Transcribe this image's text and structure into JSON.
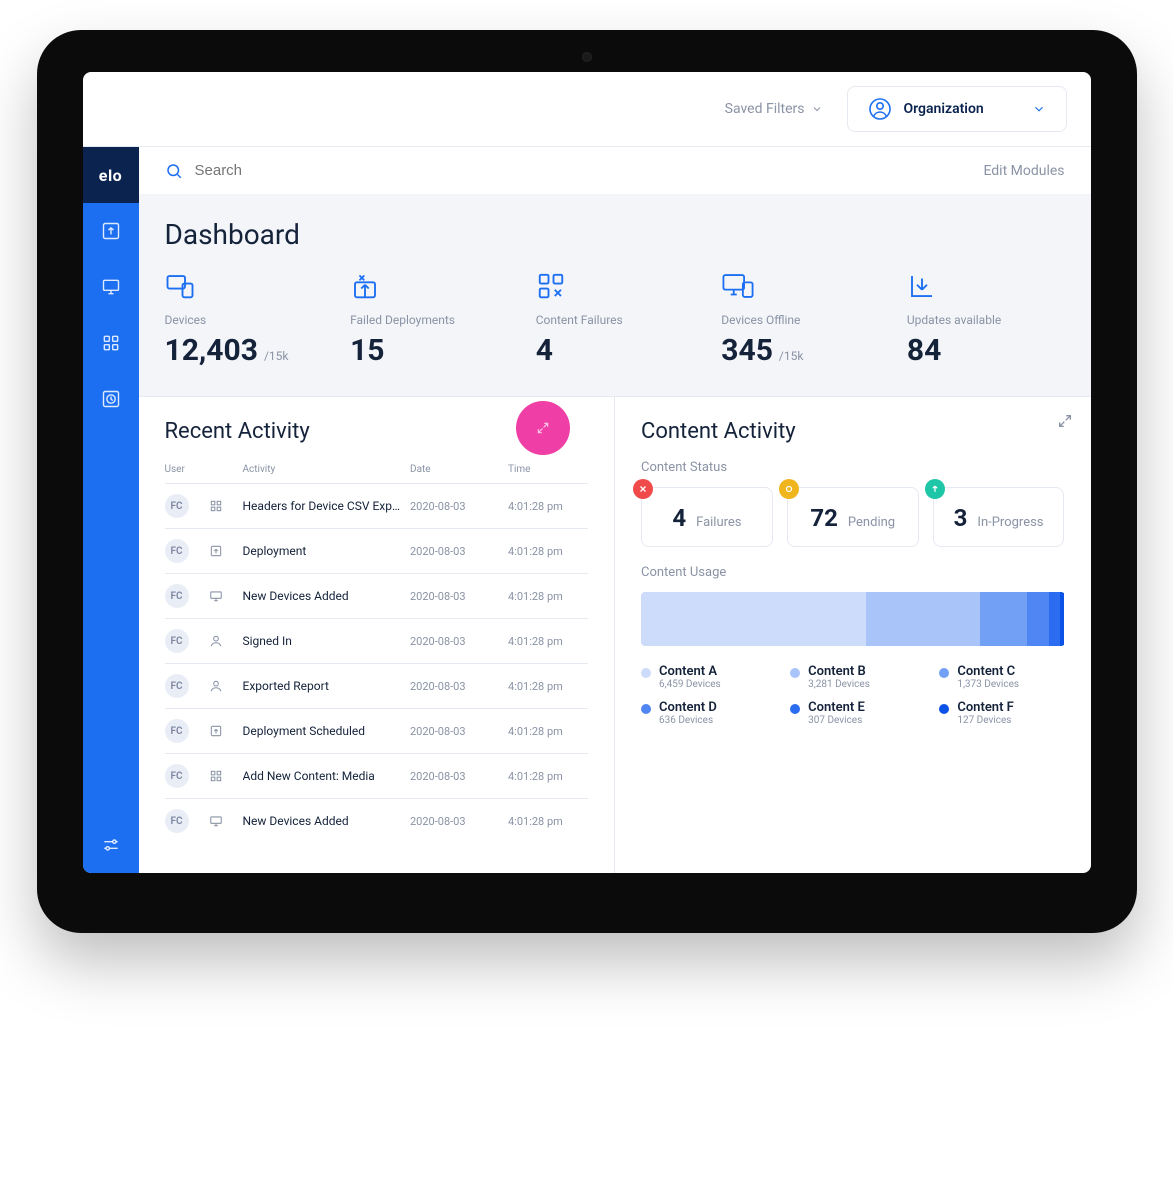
{
  "brand": {
    "logo_text": "elo"
  },
  "header": {
    "saved_filters_label": "Saved Filters",
    "organization_label": "Organization"
  },
  "search": {
    "placeholder": "Search",
    "edit_modules_label": "Edit Modules"
  },
  "dashboard": {
    "title": "Dashboard",
    "stats": [
      {
        "label": "Devices",
        "value": "12,403",
        "suffix": "/15k"
      },
      {
        "label": "Failed Deployments",
        "value": "15",
        "suffix": ""
      },
      {
        "label": "Content Failures",
        "value": "4",
        "suffix": ""
      },
      {
        "label": "Devices Offline",
        "value": "345",
        "suffix": "/15k"
      },
      {
        "label": "Updates available",
        "value": "84",
        "suffix": ""
      }
    ]
  },
  "recent_activity": {
    "title": "Recent Activity",
    "columns": {
      "user": "User",
      "activity": "Activity",
      "date": "Date",
      "time": "Time"
    },
    "rows": [
      {
        "user": "FC",
        "icon": "grid",
        "desc": "Headers for Device CSV Expo...",
        "date": "2020-08-03",
        "time": "4:01:28 pm"
      },
      {
        "user": "FC",
        "icon": "upload",
        "desc": "Deployment",
        "date": "2020-08-03",
        "time": "4:01:28 pm"
      },
      {
        "user": "FC",
        "icon": "monitor",
        "desc": "New Devices Added",
        "date": "2020-08-03",
        "time": "4:01:28 pm"
      },
      {
        "user": "FC",
        "icon": "person",
        "desc": "Signed In",
        "date": "2020-08-03",
        "time": "4:01:28 pm"
      },
      {
        "user": "FC",
        "icon": "person",
        "desc": "Exported Report",
        "date": "2020-08-03",
        "time": "4:01:28 pm"
      },
      {
        "user": "FC",
        "icon": "upload",
        "desc": "Deployment Scheduled",
        "date": "2020-08-03",
        "time": "4:01:28 pm"
      },
      {
        "user": "FC",
        "icon": "grid",
        "desc": "Add New Content: Media",
        "date": "2020-08-03",
        "time": "4:01:28 pm"
      },
      {
        "user": "FC",
        "icon": "monitor",
        "desc": "New Devices Added",
        "date": "2020-08-03",
        "time": "4:01:28 pm"
      }
    ]
  },
  "content_activity": {
    "title": "Content Activity",
    "status_label": "Content Status",
    "statuses": [
      {
        "value": "4",
        "label": "Failures",
        "color": "red"
      },
      {
        "value": "72",
        "label": "Pending",
        "color": "amber"
      },
      {
        "value": "3",
        "label": "In-Progress",
        "color": "teal"
      }
    ],
    "usage_label": "Content Usage",
    "usage": [
      {
        "name": "Content A",
        "devices": 6459,
        "devices_label": "6,459 Devices",
        "color": "#cddcfb"
      },
      {
        "name": "Content B",
        "devices": 3281,
        "devices_label": "3,281 Devices",
        "color": "#a9c4f9"
      },
      {
        "name": "Content C",
        "devices": 1373,
        "devices_label": "1,373 Devices",
        "color": "#71a0f5"
      },
      {
        "name": "Content D",
        "devices": 636,
        "devices_label": "636 Devices",
        "color": "#4f86f3"
      },
      {
        "name": "Content E",
        "devices": 307,
        "devices_label": "307 Devices",
        "color": "#2c6cf0"
      },
      {
        "name": "Content F",
        "devices": 127,
        "devices_label": "127 Devices",
        "color": "#0a53e6"
      }
    ]
  },
  "chart_data": {
    "type": "bar",
    "title": "Content Usage",
    "categories": [
      "Content A",
      "Content B",
      "Content C",
      "Content D",
      "Content E",
      "Content F"
    ],
    "values": [
      6459,
      3281,
      1373,
      636,
      307,
      127
    ],
    "ylabel": "Devices"
  }
}
